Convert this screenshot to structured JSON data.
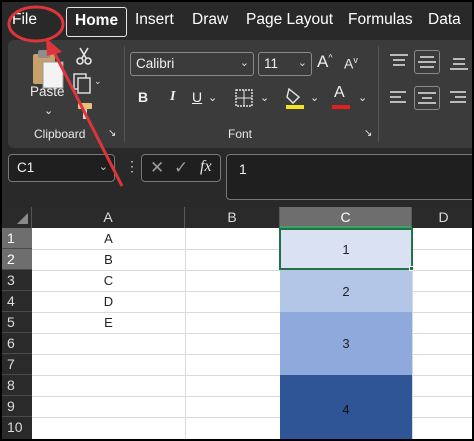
{
  "tabs": [
    "File",
    "Home",
    "Insert",
    "Draw",
    "Page Layout",
    "Formulas",
    "Data"
  ],
  "active_tab": "Home",
  "ribbon": {
    "clipboard": {
      "paste_label": "Paste",
      "group_label": "Clipboard"
    },
    "font": {
      "font_name": "Calibri",
      "font_size": "11",
      "grow_label": "A",
      "shrink_label": "A",
      "bold_label": "B",
      "italic_label": "I",
      "underline_label": "U",
      "font_color_letter": "A",
      "highlight_color": "#f4e11f",
      "font_color": "#e02020",
      "group_label": "Font"
    }
  },
  "formula_bar": {
    "name_box": "C1",
    "fx_label": "fx",
    "formula_value": "1"
  },
  "grid": {
    "columns": [
      "A",
      "B",
      "C",
      "D"
    ],
    "selected_column": "C",
    "rows": [
      "1",
      "2",
      "3",
      "4",
      "5",
      "6",
      "7",
      "8",
      "9",
      "10"
    ],
    "column_a_values": [
      "A",
      "B",
      "C",
      "D",
      "E"
    ],
    "column_c_blocks": [
      {
        "value": "1",
        "color": "#d9e1f2",
        "text_color": "#222222"
      },
      {
        "value": "2",
        "color": "#b4c6e7",
        "text_color": "#222222"
      },
      {
        "value": "3",
        "color": "#8ea9db",
        "text_color": "#222222"
      },
      {
        "value": "4",
        "color": "#2f5597",
        "text_color": "#111111"
      }
    ]
  },
  "annotation_color": "#e0343c"
}
